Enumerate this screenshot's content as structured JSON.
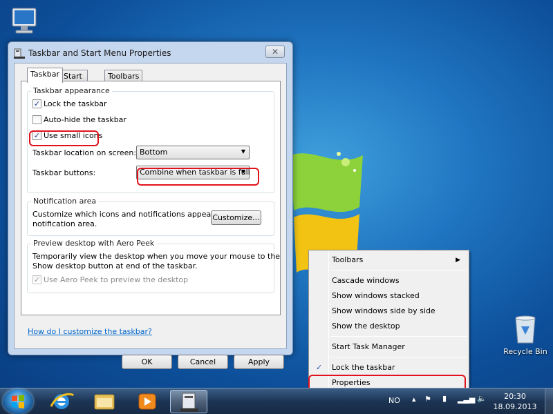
{
  "dialog": {
    "title": "Taskbar and Start Menu Properties",
    "close_glyph": "✕",
    "tabs": [
      "Taskbar",
      "Start Menu",
      "Toolbars"
    ],
    "appearance": {
      "legend": "Taskbar appearance",
      "lock_label": "Lock the taskbar",
      "lock_checked": true,
      "autohide_label": "Auto-hide the taskbar",
      "autohide_checked": false,
      "small_icons_label": "Use small icons",
      "small_icons_checked": true,
      "location_label": "Taskbar location on screen:",
      "location_value": "Bottom",
      "buttons_label": "Taskbar buttons:",
      "buttons_value": "Combine when taskbar is full"
    },
    "notification": {
      "legend": "Notification area",
      "text_line1": "Customize which icons and notifications appear in the",
      "text_line2": "notification area.",
      "customize_button": "Customize..."
    },
    "peek": {
      "legend": "Preview desktop with Aero Peek",
      "text_line1": "Temporarily view the desktop when you move your mouse to the",
      "text_line2": "Show desktop button at end of the taskbar.",
      "checkbox_label": "Use Aero Peek to preview the desktop",
      "checked": true
    },
    "help_link": "How do I customize the taskbar?",
    "buttons": {
      "ok": "OK",
      "cancel": "Cancel",
      "apply": "Apply"
    }
  },
  "context_menu": {
    "toolbars": "Toolbars",
    "cascade": "Cascade windows",
    "stacked": "Show windows stacked",
    "side_by_side": "Show windows side by side",
    "show_desktop": "Show the desktop",
    "task_manager": "Start Task Manager",
    "lock": "Lock the taskbar",
    "properties": "Properties",
    "check_glyph": "✓",
    "submenu_glyph": "▶"
  },
  "desktop": {
    "recycle_bin": "Recycle Bin"
  },
  "taskbar": {
    "language": "NO",
    "time": "20:30",
    "date": "18.09.2013"
  },
  "icons": {
    "computer": "computer-icon",
    "recycle": "recycle-bin-icon",
    "start": "windows-start-orb",
    "ie": "internet-explorer-icon",
    "explorer": "file-explorer-icon",
    "media": "media-player-icon",
    "taskbar_props": "taskbar-properties-icon"
  },
  "colors": {
    "highlight": "#e0121b",
    "link": "#0066cc",
    "desktop": "#1f74c0"
  }
}
